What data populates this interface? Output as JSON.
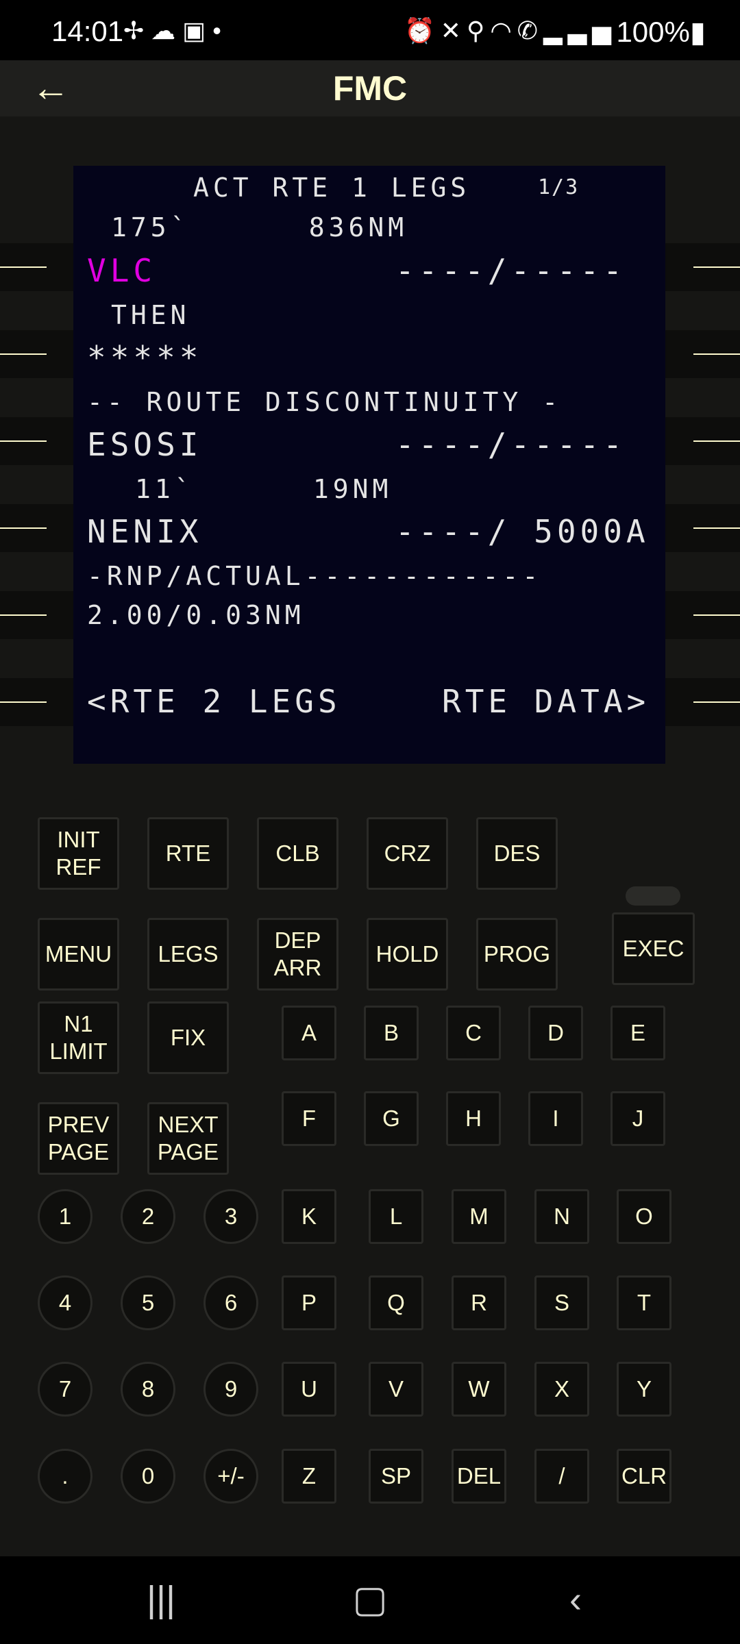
{
  "status_bar": {
    "time": "14:01",
    "left_icons": [
      "fan-icon",
      "weather-icon",
      "gallery-icon",
      "dot-icon"
    ],
    "right_icons": [
      "alarm-icon",
      "mute-icon",
      "location-icon",
      "wifi-icon",
      "wifi-call-icon",
      "signal-icon"
    ],
    "battery": "100%"
  },
  "app_bar": {
    "title": "FMC"
  },
  "cdu": {
    "title": "ACT RTE 1 LEGS",
    "page": "1/3",
    "lines": [
      "175`      836NM",
      "VLC",
      "----/-----",
      "THEN",
      "*****",
      "-- ROUTE DISCONTINUITY -",
      "ESOSI",
      "----/-----",
      "11`      19NM",
      "NENIX",
      "----/ 5000A",
      "-RNP/ACTUAL------------",
      "2.00/0.03NM",
      "<RTE 2 LEGS",
      "RTE DATA>"
    ]
  },
  "keys": {
    "init_ref": "INIT\nREF",
    "rte": "RTE",
    "clb": "CLB",
    "crz": "CRZ",
    "des": "DES",
    "menu": "MENU",
    "legs": "LEGS",
    "dep_arr": "DEP\nARR",
    "hold": "HOLD",
    "prog": "PROG",
    "exec": "EXEC",
    "n1_limit": "N1\nLIMIT",
    "fix": "FIX",
    "prev_page": "PREV\nPAGE",
    "next_page": "NEXT\nPAGE",
    "letters": [
      "A",
      "B",
      "C",
      "D",
      "E",
      "F",
      "G",
      "H",
      "I",
      "J",
      "K",
      "L",
      "M",
      "N",
      "O",
      "P",
      "Q",
      "R",
      "S",
      "T",
      "U",
      "V",
      "W",
      "X",
      "Y",
      "Z",
      "SP",
      "DEL",
      "/",
      "CLR"
    ],
    "digits": [
      "1",
      "2",
      "3",
      "4",
      "5",
      "6",
      "7",
      "8",
      "9",
      ".",
      "0",
      "+/-"
    ]
  },
  "nav_bar": {
    "icons": [
      "recent-apps-icon",
      "home-icon",
      "back-icon"
    ]
  },
  "colors": {
    "accent": "#fffbd0",
    "screen_bg": "#04041a",
    "magenta": "#e000e0"
  }
}
